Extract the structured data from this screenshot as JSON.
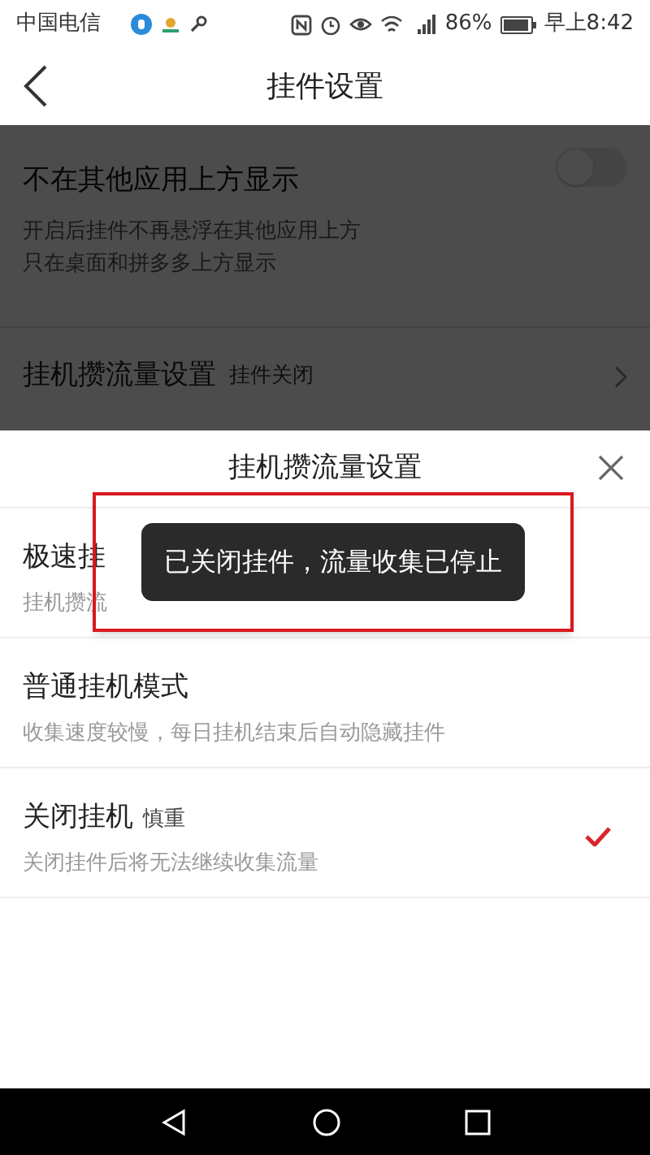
{
  "status_bar": {
    "carrier": "中国电信",
    "battery": "86%",
    "time": "早上8:42"
  },
  "header": {
    "title": "挂件设置"
  },
  "settings": [
    {
      "kind": "toggle",
      "title": "不在其他应用上方显示",
      "description": [
        "开启后挂件不再悬浮在其他应用上方",
        "只在桌面和拼多多上方显示"
      ],
      "on": false
    },
    {
      "kind": "link",
      "title": "挂机攒流量设置",
      "value": "挂件关闭"
    }
  ],
  "sheet": {
    "title": "挂机攒流量设置",
    "options": [
      {
        "title": "极速挂",
        "description": "挂机攒流",
        "selected": false
      },
      {
        "title": "普通挂机模式",
        "description": "收集速度较慢，每日挂机结束后自动隐藏挂件",
        "selected": false
      },
      {
        "title": "关闭挂机",
        "tag": "慎重",
        "description": "关闭挂件后将无法继续收集流量",
        "selected": true
      }
    ]
  },
  "toast": "已关闭挂件，流量收集已停止"
}
